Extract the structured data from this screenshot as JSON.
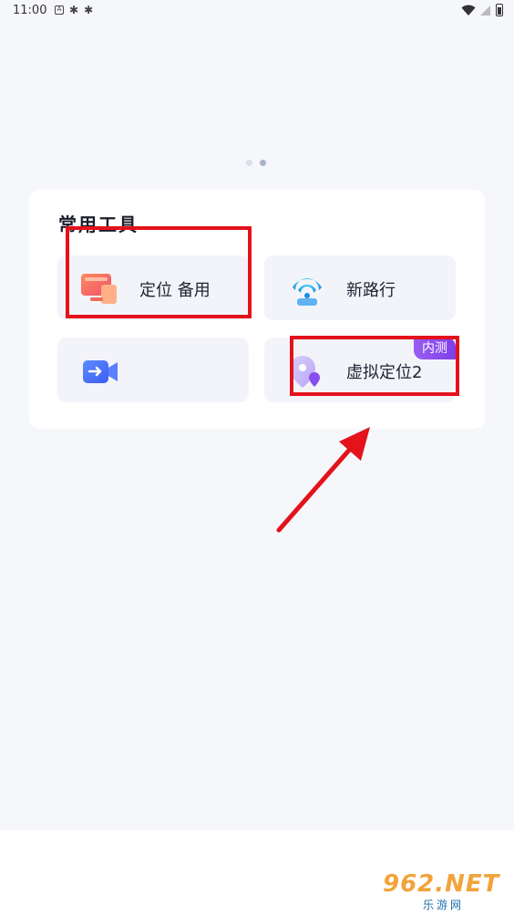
{
  "status_bar": {
    "time": "11:00"
  },
  "pager": {
    "count": 2,
    "active_index": 1
  },
  "tools": {
    "title": "常用工具",
    "items": [
      {
        "label": "定位 备用",
        "icon": "monitor-icon"
      },
      {
        "label": "新路行",
        "icon": "wifi-location-icon"
      },
      {
        "label": "",
        "icon": "video-transfer-icon"
      },
      {
        "label": "虚拟定位2",
        "icon": "map-pin-icon",
        "badge": "内测"
      }
    ]
  },
  "watermark": {
    "brand": "962.NET",
    "subtitle": "乐游网"
  },
  "colors": {
    "accent_red": "#e3121b",
    "badge_purple": "#8a4cef",
    "background": "#f6f7fb"
  }
}
